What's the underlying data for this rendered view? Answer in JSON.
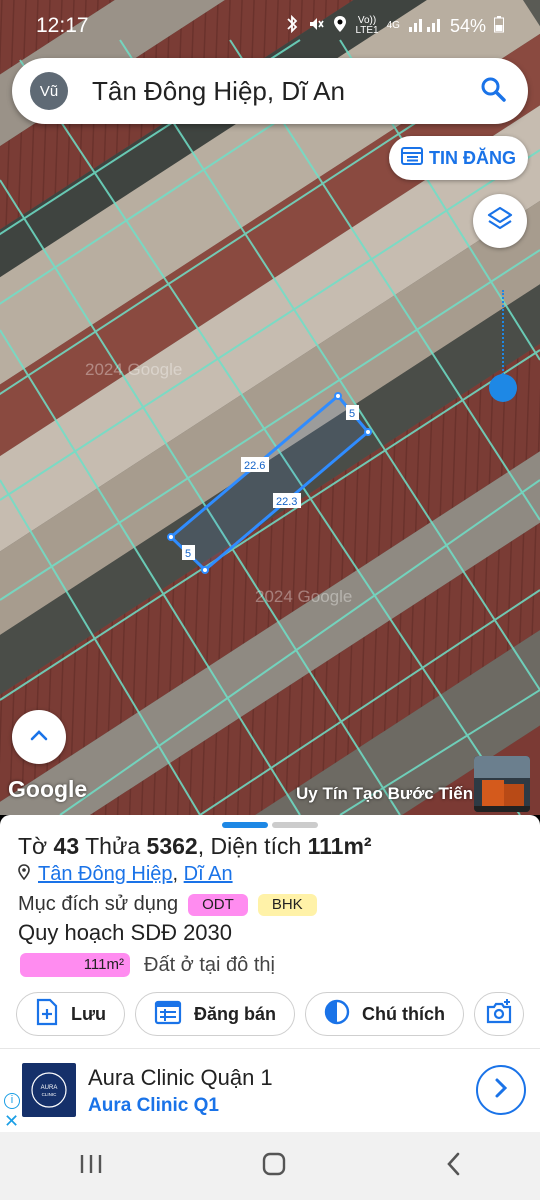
{
  "status": {
    "time": "12:17",
    "network_top": "Vo))",
    "network_bottom": "LTE1",
    "gen": "4G",
    "battery": "54%"
  },
  "search": {
    "avatar_initials": "Vũ",
    "query": "Tân Đông Hiệp, Dĩ An"
  },
  "map": {
    "tin_dang_label": "TIN ĐĂNG",
    "google_label": "Google",
    "credit": "Uy Tín Tạo Bước Tiến",
    "parcel_labels": {
      "top": "22.6",
      "bottom": "22.3",
      "side_a": "5",
      "side_b": "5"
    },
    "watermarks": [
      "2024 Google",
      "2024 Google"
    ]
  },
  "sheet": {
    "title_prefix": "Tờ ",
    "sheet_no": "43",
    "title_mid": " Thửa ",
    "parcel_no": "5362",
    "title_area_label": ", Diện tích ",
    "area": "111m²",
    "ward": "Tân Đông Hiệp",
    "sep": ",",
    "city": "Dĩ An",
    "purpose_label": "Mục đích sử dụng",
    "badges": [
      {
        "label": "ODT",
        "color": "#ff8cf0"
      },
      {
        "label": "BHK",
        "color": "#fff2a8"
      }
    ],
    "plan_label": "Quy hoạch SDĐ 2030",
    "plan_area": "111m²",
    "plan_desc": "Đất ở tại đô thị",
    "actions": {
      "save": "Lưu",
      "sell": "Đăng bán",
      "legend": "Chú thích"
    }
  },
  "ad": {
    "logo_top": "AURA",
    "logo_bottom": "CLINIC",
    "title": "Aura Clinic Quận 1",
    "subtitle": "Aura Clinic Q1"
  }
}
